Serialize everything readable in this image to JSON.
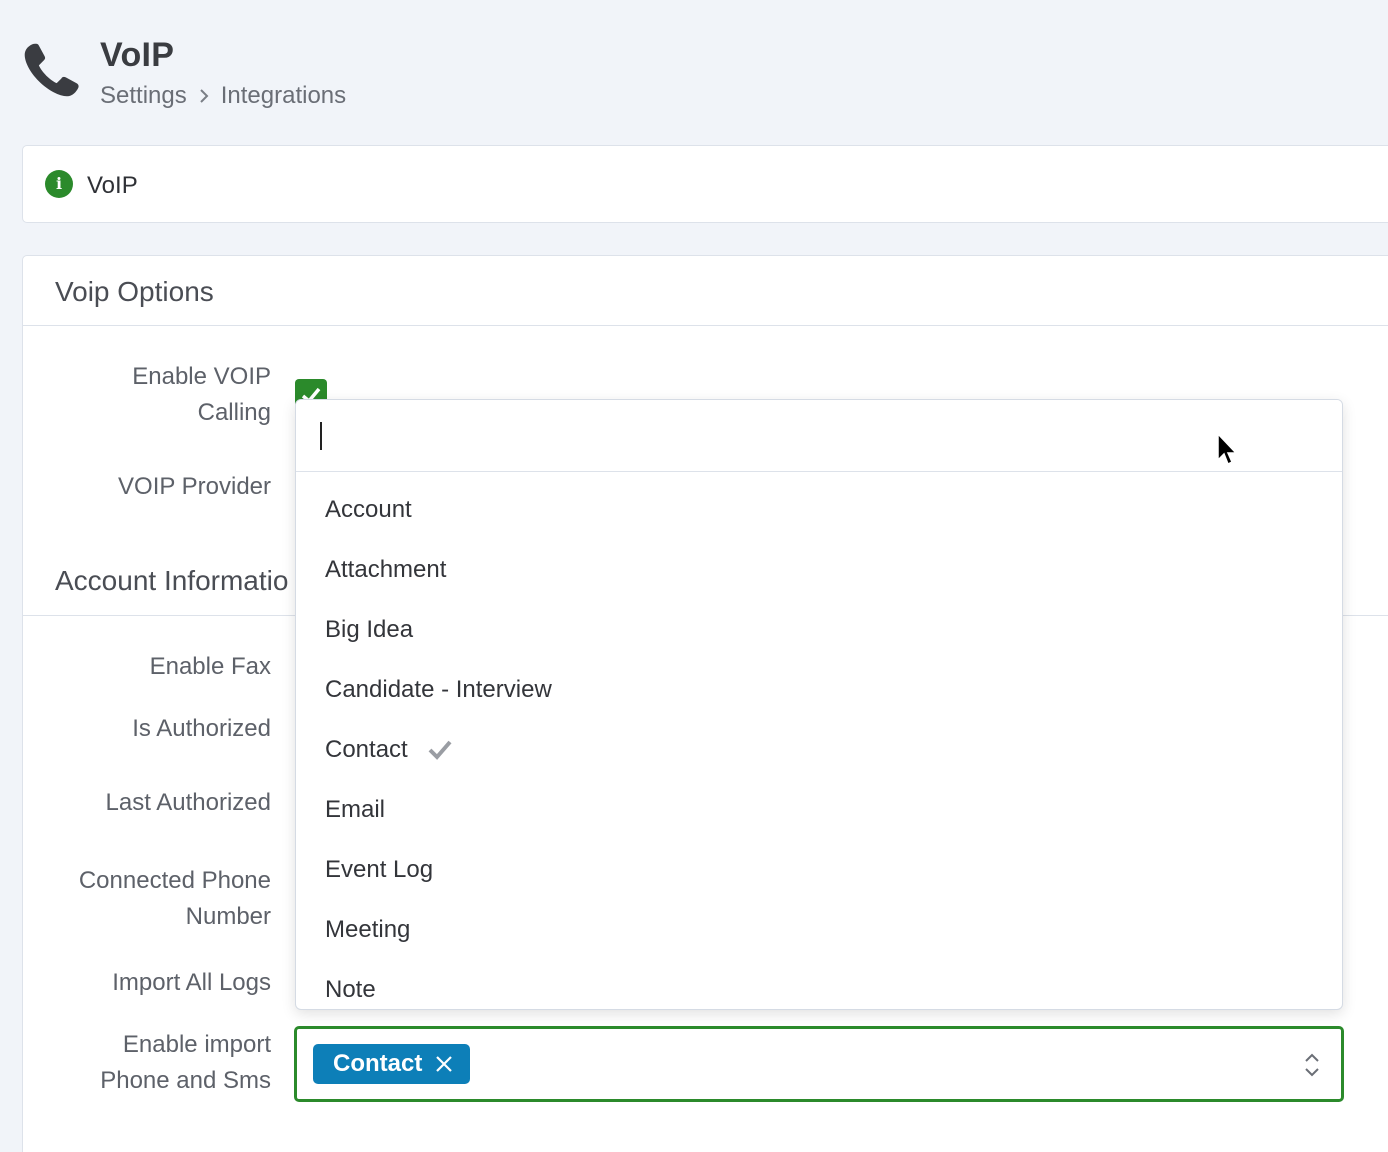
{
  "header": {
    "title": "VoIP",
    "breadcrumb": [
      "Settings",
      "Integrations"
    ],
    "icon": "phone-icon"
  },
  "info_card": {
    "label": "VoIP",
    "icon": "info-icon",
    "icon_glyph": "i",
    "icon_color": "#2b8a2b"
  },
  "voip_options": {
    "title": "Voip Options",
    "enable_voip_label": [
      "Enable VOIP",
      "Calling"
    ],
    "enable_voip_checked": true,
    "voip_provider_label": "VOIP Provider"
  },
  "account_info": {
    "title": "Account Informatio",
    "fields": {
      "enable_fax": "Enable Fax",
      "is_authorized": "Is Authorized",
      "last_authorized": "Last Authorized",
      "connected_phone": [
        "Connected Phone",
        "Number"
      ],
      "import_all_logs": "Import All Logs",
      "enable_import": [
        "Enable import",
        "Phone and Sms"
      ]
    }
  },
  "dropdown": {
    "search_value": "",
    "items": [
      "Account",
      "Attachment",
      "Big Idea",
      "Candidate - Interview",
      "Contact",
      "Email",
      "Event Log",
      "Meeting",
      "Note"
    ],
    "selected": "Contact"
  },
  "select": {
    "tags": [
      "Contact"
    ]
  },
  "colors": {
    "accent_green": "#2b8a2b",
    "tag_blue": "#0d7fb8"
  }
}
